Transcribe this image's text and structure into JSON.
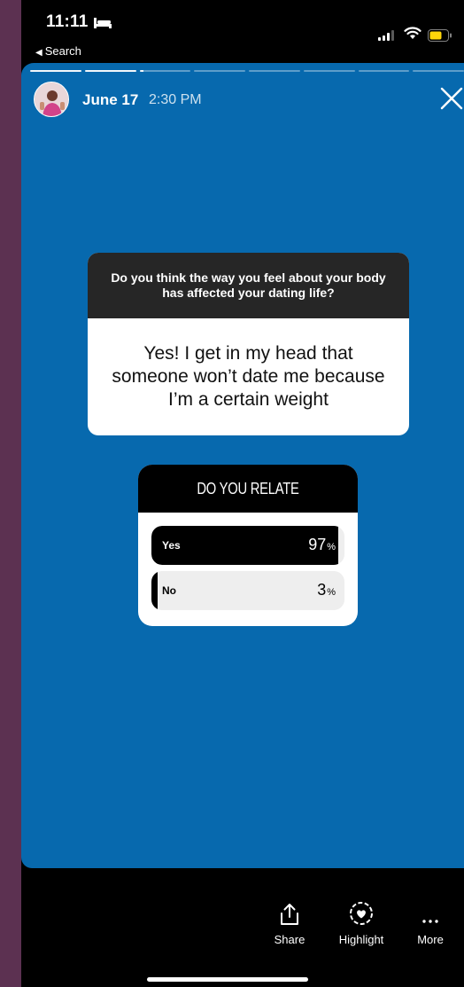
{
  "status_bar": {
    "time": "11:11",
    "back_label": "Search"
  },
  "story": {
    "date": "June 17",
    "time": "2:30 PM",
    "background_color": "#0769ae"
  },
  "question_sticker": {
    "question": "Do you think the way you feel about your body has affected your dating life?",
    "answer": "Yes! I get in my head that someone won’t date me because I’m a certain weight"
  },
  "poll": {
    "title": "DO YOU RELATE",
    "options": [
      {
        "label": "Yes",
        "percent": "97",
        "percent_sign": "%",
        "value": 97
      },
      {
        "label": "No",
        "percent": "3",
        "percent_sign": "%",
        "value": 3
      }
    ]
  },
  "actions": {
    "share": "Share",
    "highlight": "Highlight",
    "more": "More"
  }
}
